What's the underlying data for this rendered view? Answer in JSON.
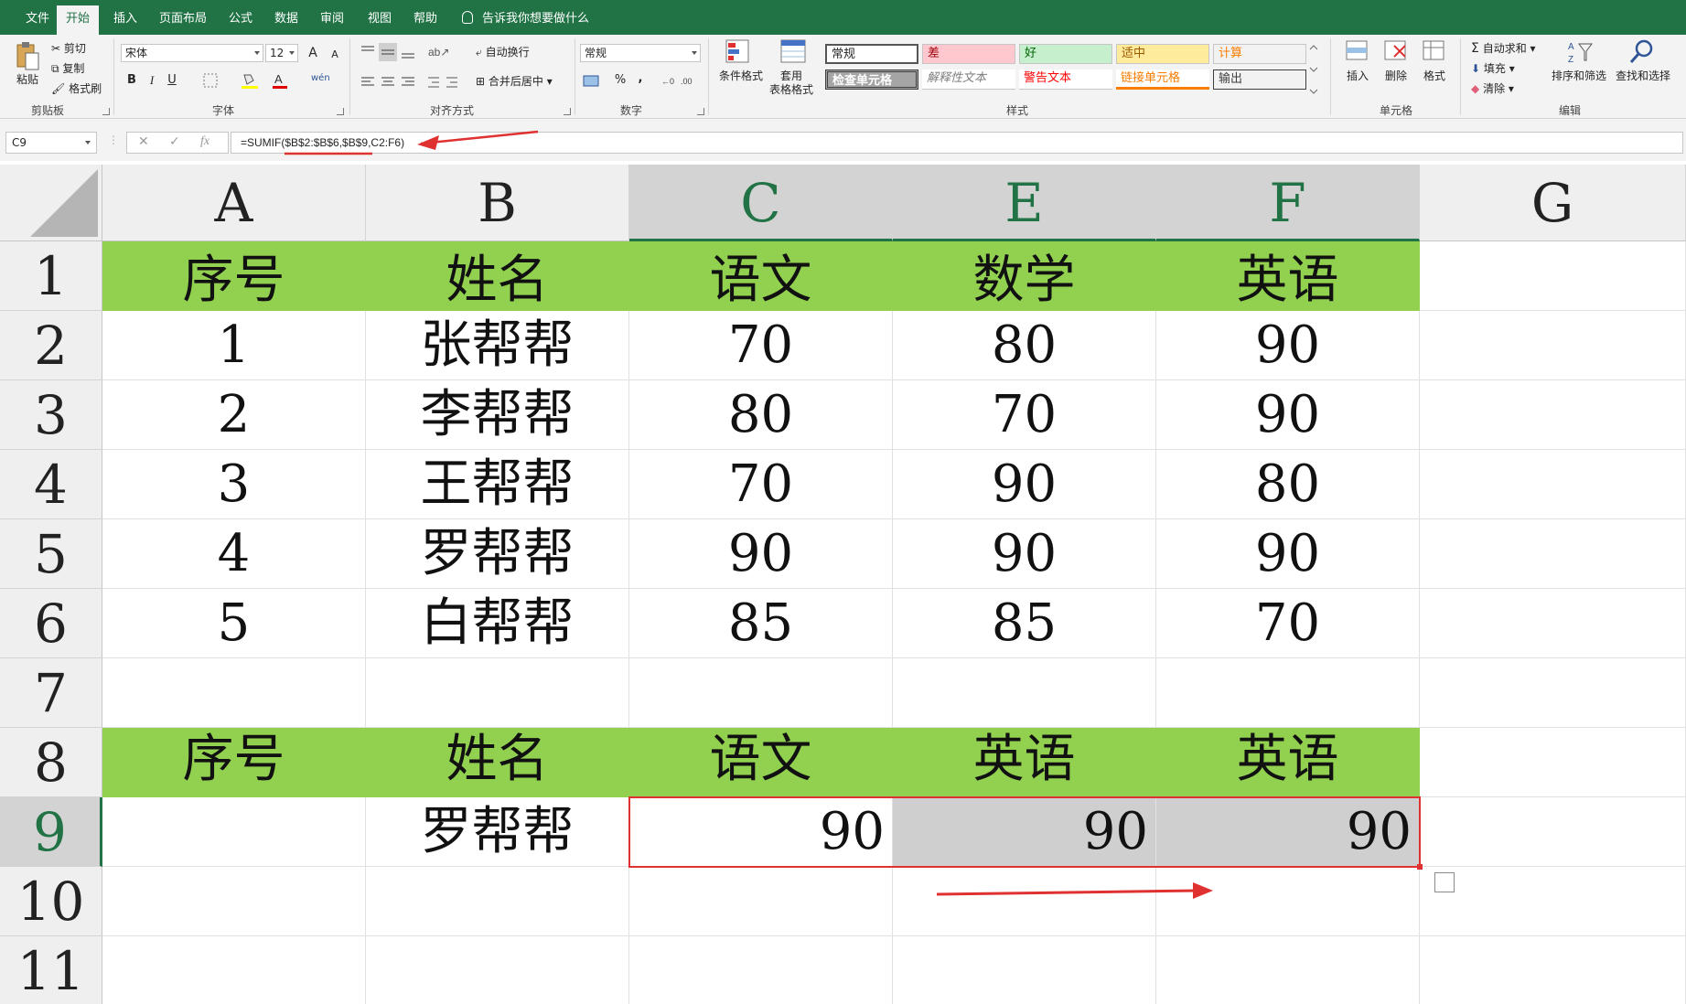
{
  "ribbon_tabs": [
    "文件",
    "开始",
    "插入",
    "页面布局",
    "公式",
    "数据",
    "审阅",
    "视图",
    "帮助"
  ],
  "active_tab": "开始",
  "tell_me": "告诉我你想要做什么",
  "clipboard": {
    "paste": "粘贴",
    "cut": "剪切",
    "copy": "复制",
    "format_painter": "格式刷",
    "label": "剪贴板"
  },
  "font": {
    "name": "宋体",
    "size": "12",
    "bold": "B",
    "italic": "I",
    "underline": "U",
    "grow": "A",
    "shrink": "A",
    "phonetic": "wén",
    "label": "字体"
  },
  "alignment": {
    "wrap": "自动换行",
    "merge": "合并后居中",
    "label": "对齐方式"
  },
  "number": {
    "format": "常规",
    "percent": "%",
    "comma": ",",
    "label": "数字"
  },
  "styles": {
    "conditional": "条件格式",
    "table_format": [
      "套用",
      "表格格式"
    ],
    "cells": [
      {
        "text": "常规",
        "bg": "#ffffff",
        "fg": "#262626"
      },
      {
        "text": "差",
        "bg": "#ffc7ce",
        "fg": "#9c0006"
      },
      {
        "text": "好",
        "bg": "#c6efce",
        "fg": "#006100"
      },
      {
        "text": "适中",
        "bg": "#ffeb9c",
        "fg": "#9c5700"
      },
      {
        "text": "计算",
        "bg": "#f2f2f2",
        "fg": "#fa7d00"
      },
      {
        "text": "检查单元格",
        "bg": "#a5a5a5",
        "fg": "#ffffff"
      },
      {
        "text": "解释性文本",
        "bg": "#ffffff",
        "fg": "#7f7f7f"
      },
      {
        "text": "警告文本",
        "bg": "#ffffff",
        "fg": "#ff0000"
      },
      {
        "text": "链接单元格",
        "bg": "#ffffff",
        "fg": "#fa7d00"
      },
      {
        "text": "输出",
        "bg": "#f2f2f2",
        "fg": "#3f3f3f"
      }
    ],
    "label": "样式"
  },
  "cells_group": {
    "insert": "插入",
    "delete": "删除",
    "format": "格式",
    "label": "单元格"
  },
  "editing": {
    "autosum": "自动求和",
    "fill": "填充",
    "clear": "清除",
    "sort": "排序和筛选",
    "find": "查找和选择",
    "label": "编辑"
  },
  "formula_bar": {
    "name_box": "C9",
    "cancel": "✕",
    "enter": "✓",
    "fx": "fx",
    "formula": "=SUMIF($B$2:$B$6,$B$9,C2:F6)"
  },
  "columns": [
    "A",
    "B",
    "C",
    "E",
    "F",
    "G"
  ],
  "selected_columns": [
    "C",
    "E",
    "F"
  ],
  "rows": [
    "1",
    "2",
    "3",
    "4",
    "5",
    "6",
    "7",
    "8",
    "9",
    "10",
    "11"
  ],
  "selected_row": "9",
  "table": {
    "header": [
      "序号",
      "姓名",
      "语文",
      "数学",
      "英语"
    ],
    "data": [
      [
        "1",
        "张帮帮",
        "70",
        "80",
        "90"
      ],
      [
        "2",
        "李帮帮",
        "80",
        "70",
        "90"
      ],
      [
        "3",
        "王帮帮",
        "70",
        "90",
        "80"
      ],
      [
        "4",
        "罗帮帮",
        "90",
        "90",
        "90"
      ],
      [
        "5",
        "白帮帮",
        "85",
        "85",
        "70"
      ]
    ],
    "lookup_header": [
      "序号",
      "姓名",
      "语文",
      "英语",
      "英语"
    ],
    "lookup_row": [
      "",
      "罗帮帮",
      "90",
      "90",
      "90"
    ]
  },
  "colors": {
    "excel_green": "#217346",
    "header_fill": "#92d050",
    "annotation_red": "#e03131"
  }
}
